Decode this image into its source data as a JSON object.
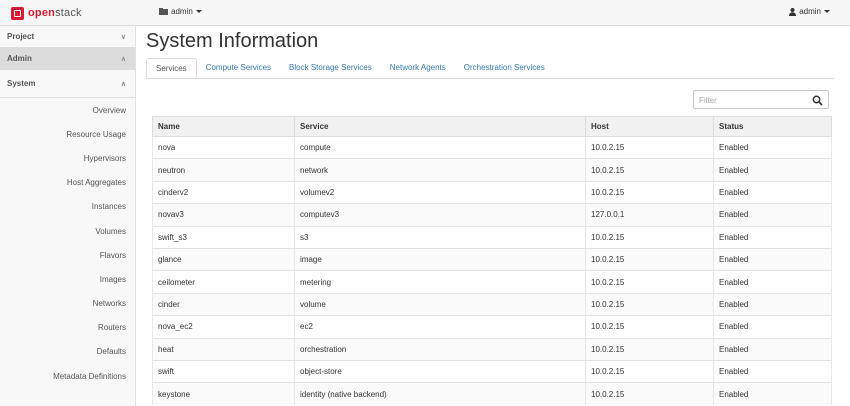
{
  "app": {
    "brand_prefix": "open",
    "brand_suffix": "stack"
  },
  "topbar": {
    "project_label": "admin",
    "user_label": "admin"
  },
  "sidebar": {
    "sections": [
      {
        "label": "Project"
      },
      {
        "label": "Admin"
      },
      {
        "label": "System"
      }
    ],
    "items": [
      {
        "label": "Overview"
      },
      {
        "label": "Resource Usage"
      },
      {
        "label": "Hypervisors"
      },
      {
        "label": "Host Aggregates"
      },
      {
        "label": "Instances"
      },
      {
        "label": "Volumes"
      },
      {
        "label": "Flavors"
      },
      {
        "label": "Images"
      },
      {
        "label": "Networks"
      },
      {
        "label": "Routers"
      },
      {
        "label": "Defaults"
      },
      {
        "label": "Metadata Definitions"
      }
    ]
  },
  "main": {
    "title": "System Information",
    "tabs": [
      {
        "label": "Services"
      },
      {
        "label": "Compute Services"
      },
      {
        "label": "Block Storage Services"
      },
      {
        "label": "Network Agents"
      },
      {
        "label": "Orchestration Services"
      }
    ],
    "filter": {
      "placeholder": "Filter",
      "value": ""
    },
    "table": {
      "headers": [
        "Name",
        "Service",
        "Host",
        "Status"
      ],
      "rows": [
        [
          "nova",
          "compute",
          "10.0.2.15",
          "Enabled"
        ],
        [
          "neutron",
          "network",
          "10.0.2.15",
          "Enabled"
        ],
        [
          "cinderv2",
          "volumev2",
          "10.0.2.15",
          "Enabled"
        ],
        [
          "novav3",
          "computev3",
          "127.0.0.1",
          "Enabled"
        ],
        [
          "swift_s3",
          "s3",
          "10.0.2.15",
          "Enabled"
        ],
        [
          "glance",
          "image",
          "10.0.2.15",
          "Enabled"
        ],
        [
          "ceilometer",
          "metering",
          "10.0.2.15",
          "Enabled"
        ],
        [
          "cinder",
          "volume",
          "10.0.2.15",
          "Enabled"
        ],
        [
          "nova_ec2",
          "ec2",
          "10.0.2.15",
          "Enabled"
        ],
        [
          "heat",
          "orchestration",
          "10.0.2.15",
          "Enabled"
        ],
        [
          "swift",
          "object-store",
          "10.0.2.15",
          "Enabled"
        ],
        [
          "keystone",
          "identity (native backend)",
          "10.0.2.15",
          "Enabled"
        ]
      ]
    }
  },
  "colors": {
    "brand_red": "#da1a32",
    "link_blue": "#337ab7"
  },
  "icons": {
    "search": "search-icon",
    "user": "user-icon",
    "folder": "folder-icon"
  }
}
